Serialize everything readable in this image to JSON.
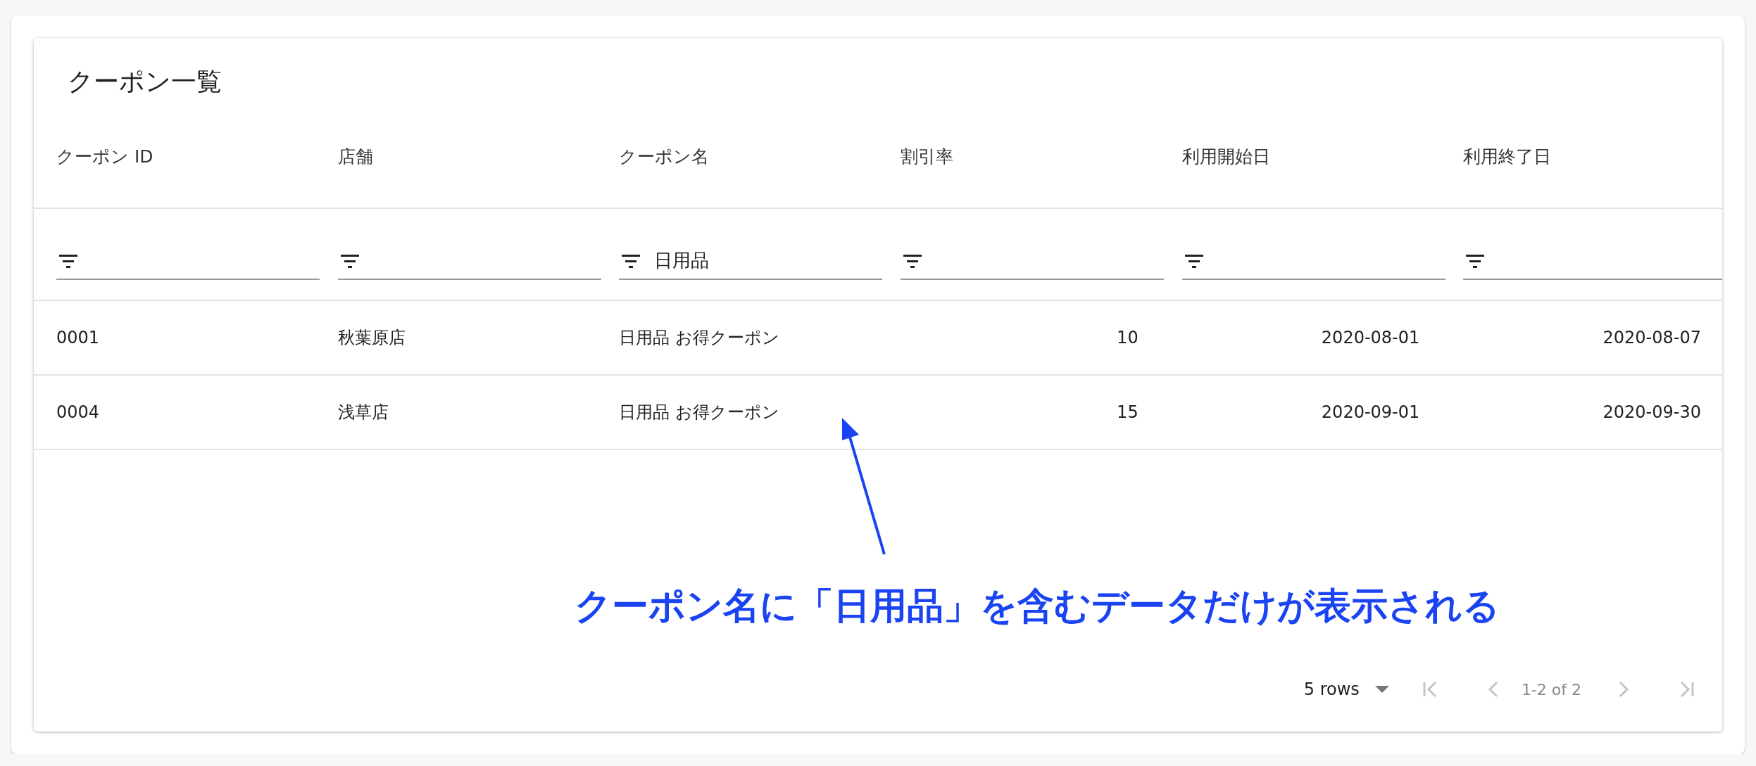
{
  "title": "クーポン一覧",
  "columns": [
    {
      "label": "クーポン ID",
      "kind": "text"
    },
    {
      "label": "店舗",
      "kind": "text"
    },
    {
      "label": "クーポン名",
      "kind": "text",
      "filter": "日用品"
    },
    {
      "label": "割引率",
      "kind": "number"
    },
    {
      "label": "利用開始日",
      "kind": "number"
    },
    {
      "label": "利用終了日",
      "kind": "number"
    }
  ],
  "rows": [
    [
      "0001",
      "秋葉原店",
      "日用品 お得クーポン",
      "10",
      "2020-08-01",
      "2020-08-07"
    ],
    [
      "0004",
      "浅草店",
      "日用品 お得クーポン",
      "15",
      "2020-09-01",
      "2020-09-30"
    ]
  ],
  "pagination": {
    "page_size": "5 rows",
    "range": "1-2 of 2",
    "first_disabled": true,
    "prev_disabled": true,
    "next_disabled": true,
    "last_disabled": true
  },
  "annotation": {
    "text": "クーポン名に「日用品」を含むデータだけが表示される"
  }
}
